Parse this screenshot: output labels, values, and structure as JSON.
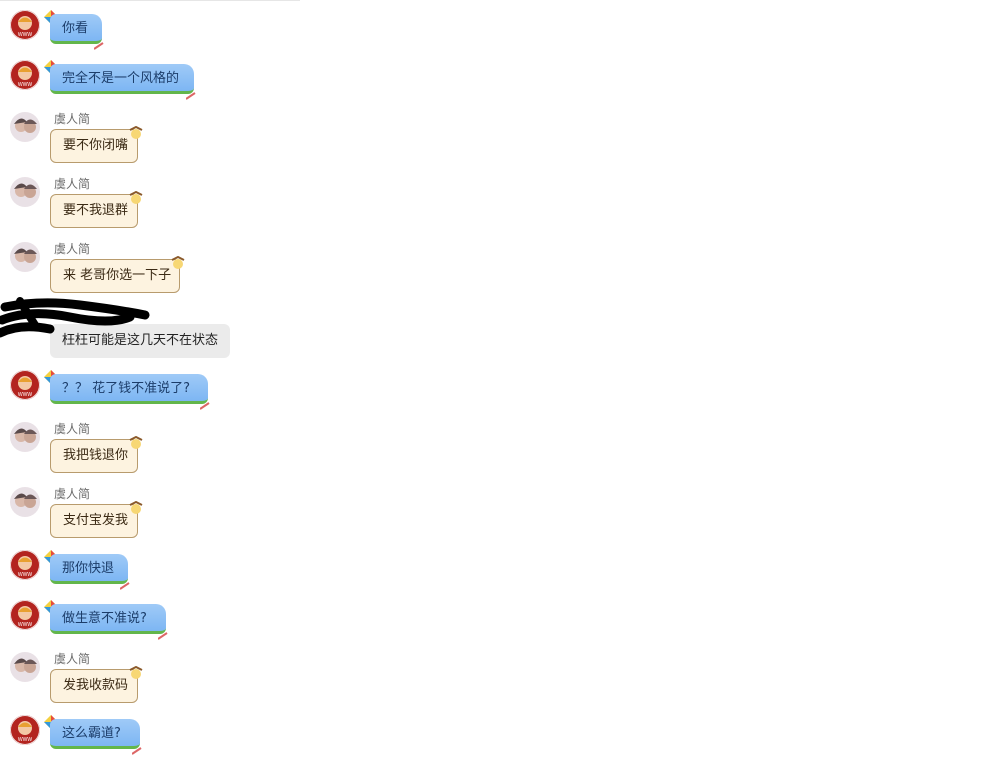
{
  "chat": {
    "messages": [
      {
        "sender": "self",
        "style": "blue",
        "text": "你看"
      },
      {
        "sender": "self",
        "style": "blue",
        "text": "完全不是一个风格的"
      },
      {
        "sender": "虞人简",
        "style": "cream",
        "text": "要不你闭嘴"
      },
      {
        "sender": "虞人简",
        "style": "cream",
        "text": "要不我退群"
      },
      {
        "sender": "虞人简",
        "style": "cream",
        "text": "来 老哥你选一下子"
      },
      {
        "sender": "redacted",
        "style": "grey",
        "text": "枉枉可能是这几天不在状态"
      },
      {
        "sender": "self",
        "style": "blue",
        "text": "？？ 花了钱不准说了?"
      },
      {
        "sender": "虞人简",
        "style": "cream",
        "text": "我把钱退你"
      },
      {
        "sender": "虞人简",
        "style": "cream",
        "text": "支付宝发我"
      },
      {
        "sender": "self",
        "style": "blue",
        "text": "那你快退"
      },
      {
        "sender": "self",
        "style": "blue",
        "text": "做生意不准说?"
      },
      {
        "sender": "虞人简",
        "style": "cream",
        "text": "发我收款码"
      },
      {
        "sender": "self",
        "style": "blue",
        "text": "这么霸道?"
      }
    ]
  },
  "icons": {
    "self_avatar": "red-round-avatar-icon",
    "other_avatar": "girls-photo-avatar-icon",
    "blue_deco": "kite-pencil-icon",
    "cream_deco": "cartoon-ribbon-icon",
    "redaction": "black-scribble"
  },
  "colors": {
    "blue_top": "#9fcaf7",
    "blue_bottom": "#7db6f3",
    "green_edge": "#63b64b",
    "cream": "#fdf3e0",
    "grey": "#ebebeb",
    "self_avatar": "#b3241f"
  }
}
